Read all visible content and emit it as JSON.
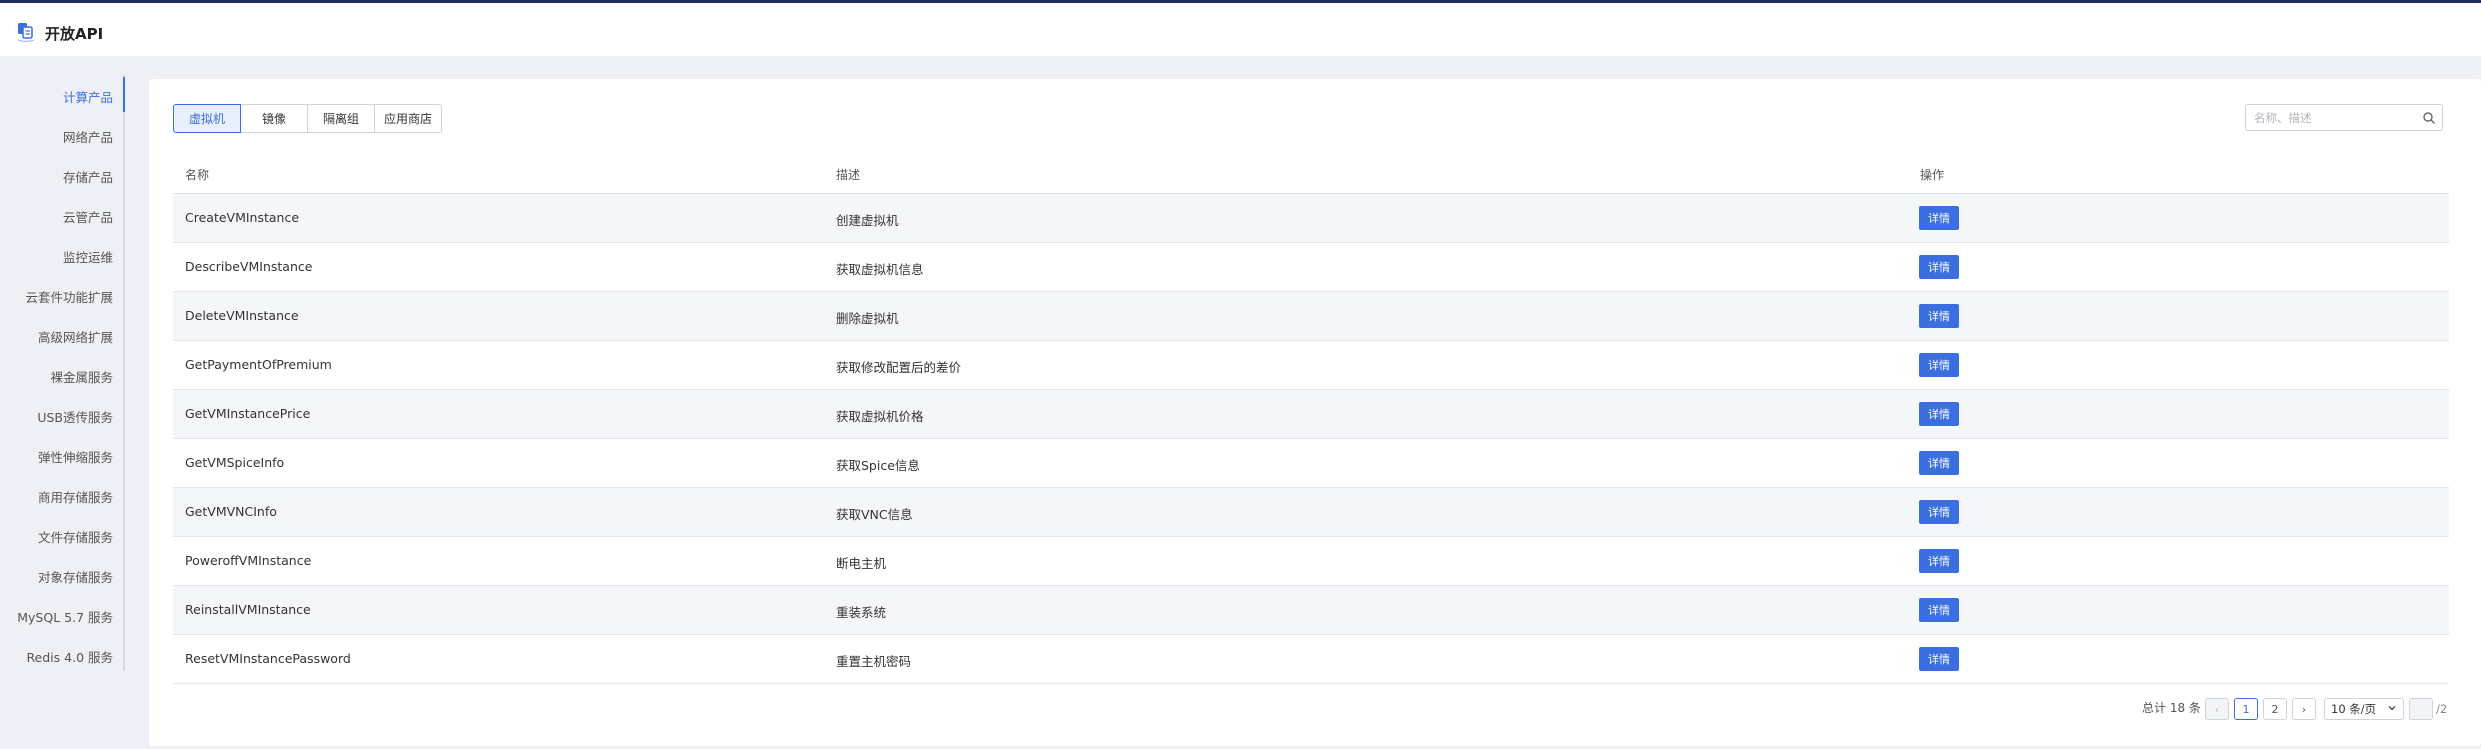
{
  "header": {
    "title": "开放API"
  },
  "sidebar": {
    "items": [
      {
        "label": "计算产品",
        "active": true
      },
      {
        "label": "网络产品"
      },
      {
        "label": "存储产品"
      },
      {
        "label": "云管产品"
      },
      {
        "label": "监控运维"
      },
      {
        "label": "云套件功能扩展"
      },
      {
        "label": "高级网络扩展"
      },
      {
        "label": "裸金属服务"
      },
      {
        "label": "USB透传服务"
      },
      {
        "label": "弹性伸缩服务"
      },
      {
        "label": "商用存储服务"
      },
      {
        "label": "文件存储服务"
      },
      {
        "label": "对象存储服务"
      },
      {
        "label": "MySQL 5.7 服务"
      },
      {
        "label": "Redis 4.0 服务"
      }
    ]
  },
  "tabs": [
    {
      "label": "虚拟机",
      "active": true
    },
    {
      "label": "镜像"
    },
    {
      "label": "隔离组"
    },
    {
      "label": "应用商店"
    }
  ],
  "search": {
    "placeholder": "名称、描述",
    "value": ""
  },
  "table": {
    "columns": [
      "名称",
      "描述",
      "操作"
    ],
    "detail_label": "详情",
    "rows": [
      {
        "name": "CreateVMInstance",
        "desc": "创建虚拟机"
      },
      {
        "name": "DescribeVMInstance",
        "desc": "获取虚拟机信息"
      },
      {
        "name": "DeleteVMInstance",
        "desc": "删除虚拟机"
      },
      {
        "name": "GetPaymentOfPremium",
        "desc": "获取修改配置后的差价"
      },
      {
        "name": "GetVMInstancePrice",
        "desc": "获取虚拟机价格"
      },
      {
        "name": "GetVMSpiceInfo",
        "desc": "获取Spice信息"
      },
      {
        "name": "GetVMVNCInfo",
        "desc": "获取VNC信息"
      },
      {
        "name": "PoweroffVMInstance",
        "desc": "断电主机"
      },
      {
        "name": "ReinstallVMInstance",
        "desc": "重装系统"
      },
      {
        "name": "ResetVMInstancePassword",
        "desc": "重置主机密码"
      }
    ]
  },
  "pagination": {
    "total_text": "总计 18 条",
    "prev": "‹",
    "next": "›",
    "pages": [
      "1",
      "2"
    ],
    "current_page": "1",
    "page_size": "10 条/页",
    "of_total": "/2",
    "jump_value": ""
  },
  "colors": {
    "accent": "#3b6fe0",
    "topbar_border": "#1f2d5a",
    "background": "#eff0f5"
  }
}
